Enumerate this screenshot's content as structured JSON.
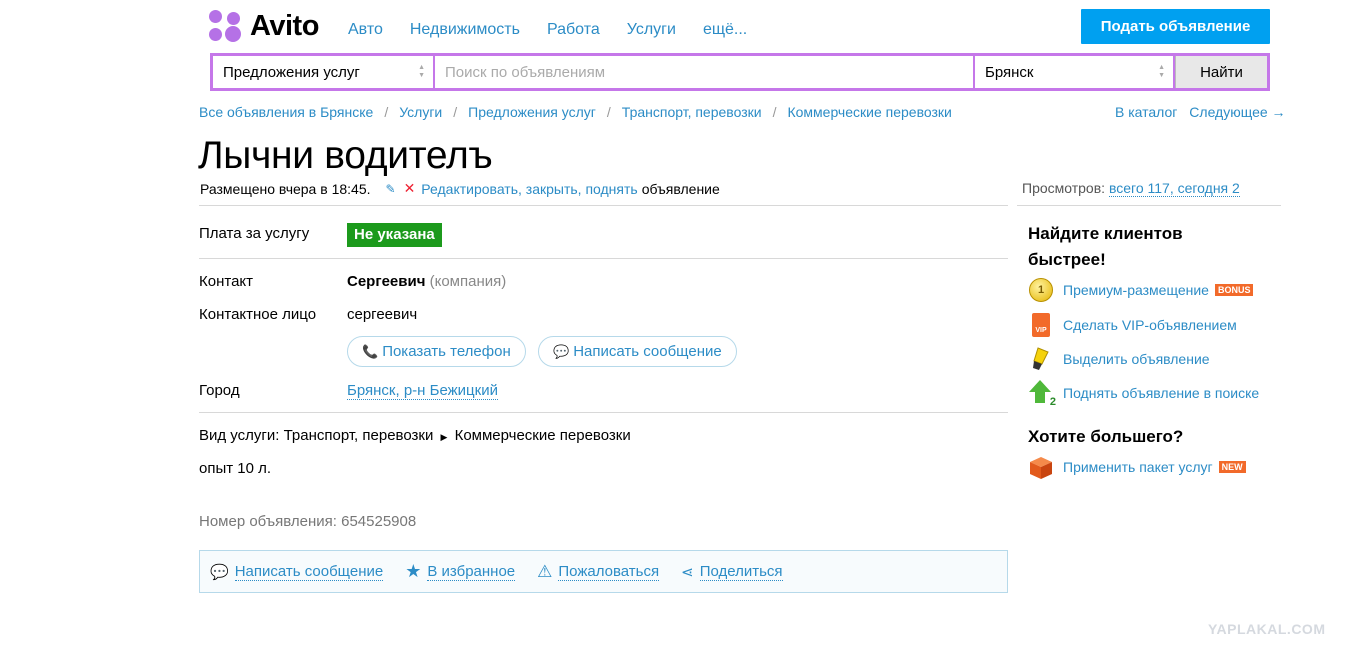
{
  "header": {
    "logo_text": "Avito",
    "nav": [
      "Авто",
      "Недвижимость",
      "Работа",
      "Услуги",
      "ещё..."
    ],
    "post_button": "Подать объявление"
  },
  "search": {
    "category": "Предложения услуг",
    "placeholder": "Поиск по объявлениям",
    "city": "Брянск",
    "button": "Найти"
  },
  "breadcrumbs": [
    "Все объявления в Брянске",
    "Услуги",
    "Предложения услуг",
    "Транспорт, перевозки",
    "Коммерческие перевозки"
  ],
  "catalog_nav": {
    "catalog": "В каталог",
    "next": "Следующее →"
  },
  "ad": {
    "title": "Лычни водителъ",
    "posted": "Размещено вчера в 18:45.",
    "edit_links": "Редактировать, закрыть, поднять",
    "edit_suffix": "объявление",
    "price_label": "Плата за услугу",
    "price_value": "Не указана",
    "contact_label": "Контакт",
    "contact_name": "Сергеевич",
    "contact_type": "(компания)",
    "person_label": "Контактное лицо",
    "person_value": "сергеевич",
    "show_phone": "Показать телефон",
    "write_message": "Написать сообщение",
    "city_label": "Город",
    "city_value": "Брянск, р-н Бежицкий",
    "service_type_prefix": "Вид услуги: Транспорт, перевозки",
    "service_type_sub": "Коммерческие перевозки",
    "description": "опыт 10 л.",
    "ad_number": "Номер объявления: 654525908"
  },
  "actions": [
    "Написать сообщение",
    "В избранное",
    "Пожаловаться",
    "Поделиться"
  ],
  "sidebar": {
    "views_prefix": "Просмотров:",
    "views_value": "всего 117, сегодня 2",
    "promo_title": "Найдите клиентов быстрее!",
    "promo_items": [
      {
        "label": "Премиум-размещение",
        "badge": "BONUS",
        "coin": "1"
      },
      {
        "label": "Сделать VIP-объявлением",
        "vip": "VIP"
      },
      {
        "label": "Выделить объявление"
      },
      {
        "label": "Поднять объявление в поиске",
        "sub": "2"
      }
    ],
    "more_title": "Хотите большего?",
    "package_label": "Применить пакет услуг",
    "package_badge": "NEW"
  },
  "watermark": "YAPLAKAL.COM",
  "colors": {
    "accent": "#2c8cc6",
    "brand": "#b571e6",
    "post_button": "#00a0f0",
    "price_badge": "#1c9a1c"
  }
}
